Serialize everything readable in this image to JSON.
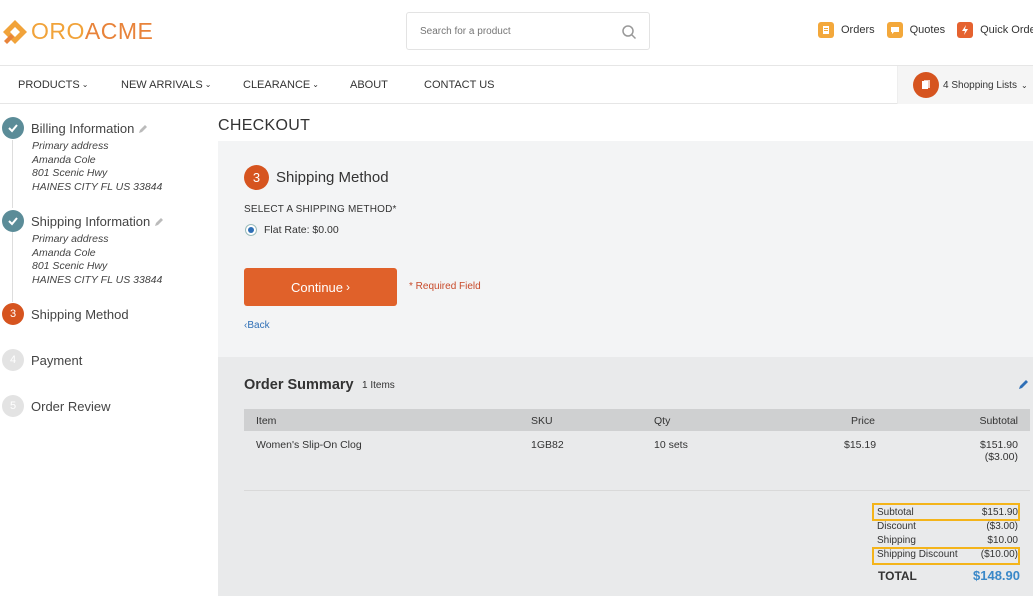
{
  "brand": {
    "prefix": "ORO",
    "suffix": "ACME",
    "accent": "#f1a33a",
    "accent2": "#e8833a"
  },
  "search": {
    "placeholder": "Search for a product"
  },
  "header_links": [
    {
      "label": "Orders",
      "icon": "orders-icon"
    },
    {
      "label": "Quotes",
      "icon": "quotes-icon"
    },
    {
      "label": "Quick Order F",
      "icon": "quick-order-icon"
    }
  ],
  "nav": {
    "items": [
      "PRODUCTS",
      "NEW ARRIVALS",
      "CLEARANCE",
      "ABOUT",
      "CONTACT US"
    ],
    "shopping_lists": "4 Shopping Lists"
  },
  "steps": [
    {
      "number": "1",
      "title": "Billing Information",
      "state": "done",
      "address": [
        "Primary address",
        "Amanda Cole",
        "801 Scenic Hwy",
        "HAINES CITY FL US 33844"
      ]
    },
    {
      "number": "2",
      "title": "Shipping Information",
      "state": "done",
      "address": [
        "Primary address",
        "Amanda Cole",
        "801 Scenic Hwy",
        "HAINES CITY FL US 33844"
      ]
    },
    {
      "number": "3",
      "title": "Shipping Method",
      "state": "active"
    },
    {
      "number": "4",
      "title": "Payment",
      "state": "pending"
    },
    {
      "number": "5",
      "title": "Order Review",
      "state": "pending"
    }
  ],
  "checkout": {
    "title": "CHECKOUT",
    "step_number": "3",
    "step_title": "Shipping Method",
    "select_label": "SELECT A SHIPPING METHOD*",
    "option": "Flat Rate: $0.00",
    "continue": "Continue",
    "required": "* Required Field",
    "back": "Back"
  },
  "summary": {
    "title": "Order Summary",
    "count": "1 Items",
    "columns": [
      "Item",
      "SKU",
      "Qty",
      "Price",
      "Subtotal"
    ],
    "rows": [
      {
        "item": "Women's Slip-On Clog",
        "sku": "1GB82",
        "qty": "10 sets",
        "price": "$15.19",
        "subtotal": "$151.90",
        "discount": "($3.00)"
      }
    ],
    "totals": [
      {
        "label": "Subtotal",
        "value": "$151.90"
      },
      {
        "label": "Discount",
        "value": "($3.00)"
      },
      {
        "label": "Shipping",
        "value": "$10.00"
      },
      {
        "label": "Shipping Discount",
        "value": "($10.00)"
      }
    ],
    "total_label": "TOTAL",
    "total_value": "$148.90"
  }
}
